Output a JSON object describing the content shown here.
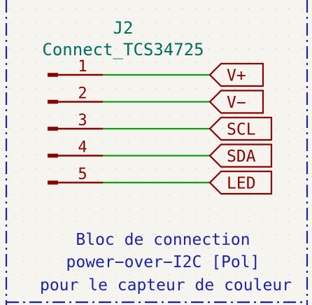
{
  "colors": {
    "background": "#f5f4ef",
    "grid_dot": "#c8c8c8",
    "border": "#1e22a8",
    "ref_text": "#006b5f",
    "pin": "#8b0000",
    "wire": "#0f9d0f",
    "label_box": "#8b0000",
    "note_text": "#1e22a8"
  },
  "component": {
    "reference": "J2",
    "value": "Connect_TCS34725"
  },
  "pins": [
    {
      "number": "1",
      "net_label": "V+"
    },
    {
      "number": "2",
      "net_label": "V−"
    },
    {
      "number": "3",
      "net_label": "SCL"
    },
    {
      "number": "4",
      "net_label": "SDA"
    },
    {
      "number": "5",
      "net_label": "LED"
    }
  ],
  "note": {
    "line1": "Bloc de connection",
    "line2": "power−over−I2C [Pol]",
    "line3": "pour le capteur de couleur"
  }
}
